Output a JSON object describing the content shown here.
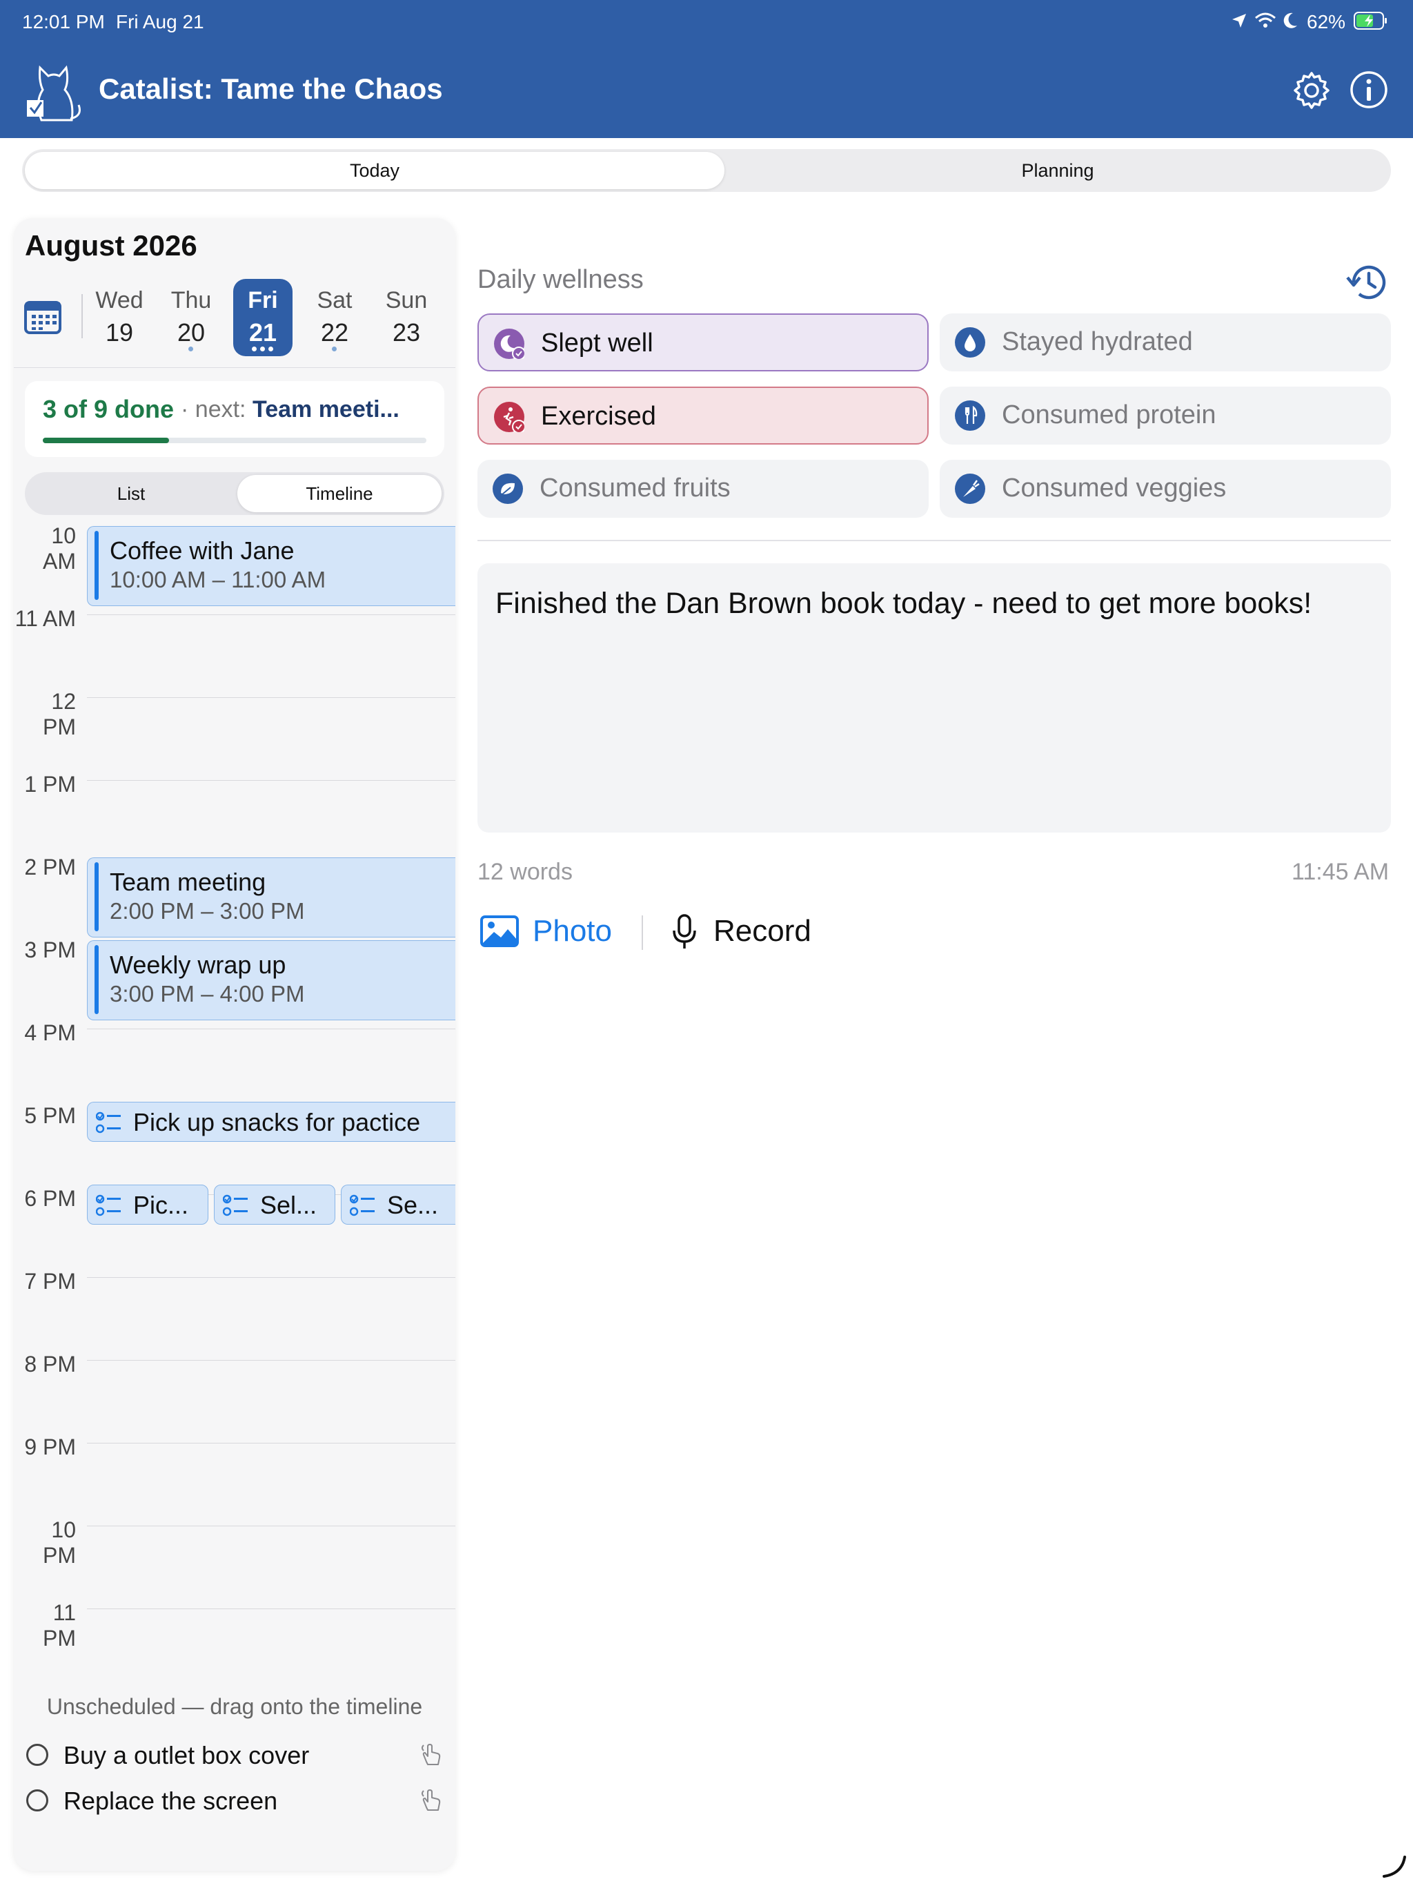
{
  "status": {
    "time": "12:01 PM",
    "date": "Fri Aug 21",
    "battery": "62%"
  },
  "header": {
    "title": "Catalist: Tame the Chaos"
  },
  "tabs": [
    "Today",
    "Planning"
  ],
  "week": {
    "month": "August 2026",
    "days": [
      {
        "name": "Wed",
        "num": "19"
      },
      {
        "name": "Thu",
        "num": "20"
      },
      {
        "name": "Fri",
        "num": "21"
      },
      {
        "name": "Sat",
        "num": "22"
      },
      {
        "name": "Sun",
        "num": "23"
      }
    ]
  },
  "progress": {
    "done": "3 of 9 done",
    "separator": "·",
    "next_label": "next:",
    "next_value": "Team meeti...",
    "fraction": 0.33
  },
  "view_toggle": [
    "List",
    "Timeline"
  ],
  "timeline": {
    "hours": [
      "10 AM",
      "11 AM",
      "12 PM",
      "1 PM",
      "2 PM",
      "3 PM",
      "4 PM",
      "5 PM",
      "6 PM",
      "7 PM",
      "8 PM",
      "9 PM",
      "10 PM",
      "11 PM"
    ],
    "events": [
      {
        "title": "Coffee with Jane",
        "time": "10:00 AM – 11:00 AM"
      },
      {
        "title": "Team meeting",
        "time": "2:00 PM – 3:00 PM"
      },
      {
        "title": "Weekly wrap up",
        "time": "3:00 PM – 4:00 PM"
      }
    ],
    "tasks": [
      {
        "title": "Pick up snacks for pactice"
      },
      {
        "title": "Pic..."
      },
      {
        "title": "Sel..."
      },
      {
        "title": "Se..."
      }
    ]
  },
  "unscheduled": {
    "heading": "Unscheduled — drag onto the timeline",
    "items": [
      "Buy a outlet box cover",
      "Replace the screen"
    ]
  },
  "wellness": {
    "title": "Daily wellness",
    "items": [
      {
        "label": "Slept well",
        "checked": true,
        "color": "#8a5bb0",
        "icon": "moon-icon"
      },
      {
        "label": "Stayed hydrated",
        "checked": false,
        "icon": "water-drop-icon"
      },
      {
        "label": "Exercised",
        "checked": true,
        "color": "#c0344c",
        "icon": "running-icon"
      },
      {
        "label": "Consumed protein",
        "checked": false,
        "icon": "utensils-icon"
      },
      {
        "label": "Consumed fruits",
        "checked": false,
        "icon": "leaf-icon"
      },
      {
        "label": "Consumed veggies",
        "checked": false,
        "icon": "carrot-icon"
      }
    ]
  },
  "journal": {
    "text": "Finished the Dan Brown book today - need to get more books!",
    "word_count": "12 words",
    "saved_time": "11:45 AM"
  },
  "actions": {
    "photo": "Photo",
    "record": "Record"
  },
  "colors": {
    "brand": "#2f5ea6",
    "accent": "#1a7ae6",
    "success": "#1e7a48"
  }
}
